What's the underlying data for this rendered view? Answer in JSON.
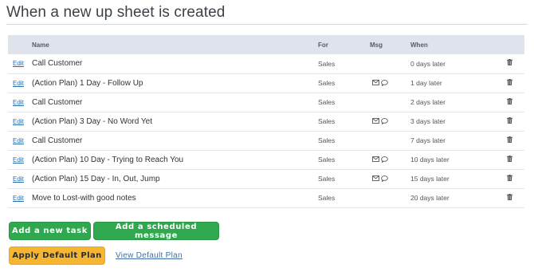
{
  "page": {
    "title": "When a new up sheet is created"
  },
  "table": {
    "columns": {
      "name": "Name",
      "for": "For",
      "msg": "Msg",
      "when": "When"
    },
    "edit_label": "Edit",
    "rows": [
      {
        "name": "Call Customer",
        "for": "Sales",
        "msg": false,
        "when": "0 days later"
      },
      {
        "name": "(Action Plan) 1 Day - Follow Up",
        "for": "Sales",
        "msg": true,
        "when": "1 day later"
      },
      {
        "name": "Call Customer",
        "for": "Sales",
        "msg": false,
        "when": "2 days later"
      },
      {
        "name": "(Action Plan) 3 Day - No Word Yet",
        "for": "Sales",
        "msg": true,
        "when": "3 days later"
      },
      {
        "name": "Call Customer",
        "for": "Sales",
        "msg": false,
        "when": "7 days later"
      },
      {
        "name": "(Action Plan) 10 Day - Trying to Reach You",
        "for": "Sales",
        "msg": true,
        "when": "10 days later"
      },
      {
        "name": "(Action Plan) 15 Day - In, Out, Jump",
        "for": "Sales",
        "msg": true,
        "when": "15 days later"
      },
      {
        "name": "Move to Lost-with good notes",
        "for": "Sales",
        "msg": false,
        "when": "20 days later"
      }
    ]
  },
  "buttons": {
    "add_task": "Add a new task",
    "add_message": "Add a scheduled message",
    "apply_plan": "Apply Default Plan",
    "view_plan": "View Default Plan"
  },
  "icons": {
    "message": [
      "envelope-icon",
      "chat-bubble-icon"
    ],
    "delete": "trash-icon"
  },
  "colors": {
    "primary_green": "#2fa84f",
    "warning_yellow": "#f7b631",
    "link_blue": "#2a6aa8",
    "header_bg": "#dfe3ec"
  }
}
